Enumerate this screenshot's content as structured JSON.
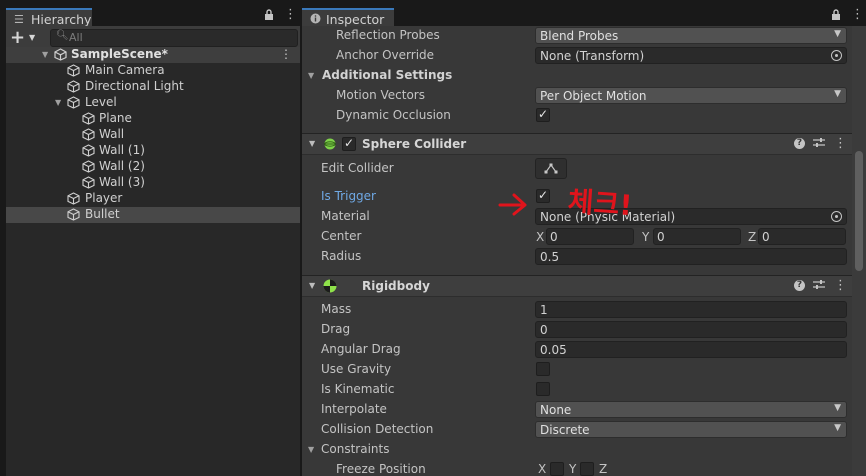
{
  "hierarchy": {
    "tab_label": "Hierarchy",
    "add_label": "+",
    "search_placeholder": "All",
    "scene": "SampleScene*",
    "items": [
      {
        "label": "Main Camera"
      },
      {
        "label": "Directional Light"
      },
      {
        "label": "Level"
      },
      {
        "label": "Plane"
      },
      {
        "label": "Wall"
      },
      {
        "label": "Wall (1)"
      },
      {
        "label": "Wall (2)"
      },
      {
        "label": "Wall (3)"
      },
      {
        "label": "Player"
      },
      {
        "label": "Bullet"
      }
    ]
  },
  "inspector": {
    "tab_label": "Inspector",
    "renderer": {
      "reflection_probes_label": "Reflection Probes",
      "reflection_probes_value": "Blend Probes",
      "anchor_override_label": "Anchor Override",
      "anchor_override_value": "None (Transform)",
      "additional_settings_label": "Additional Settings",
      "motion_vectors_label": "Motion Vectors",
      "motion_vectors_value": "Per Object Motion",
      "dynamic_occlusion_label": "Dynamic Occlusion",
      "dynamic_occlusion_checked": true
    },
    "sphere_collider": {
      "title": "Sphere Collider",
      "enabled": true,
      "edit_collider_label": "Edit Collider",
      "is_trigger_label": "Is Trigger",
      "is_trigger_checked": true,
      "material_label": "Material",
      "material_value": "None (Physic Material)",
      "center_label": "Center",
      "center": {
        "x": "0",
        "y": "0",
        "z": "0"
      },
      "axis_labels": {
        "x": "X",
        "y": "Y",
        "z": "Z"
      },
      "radius_label": "Radius",
      "radius_value": "0.5"
    },
    "rigidbody": {
      "title": "Rigidbody",
      "mass_label": "Mass",
      "mass_value": "1",
      "drag_label": "Drag",
      "drag_value": "0",
      "angular_drag_label": "Angular Drag",
      "angular_drag_value": "0.05",
      "use_gravity_label": "Use Gravity",
      "use_gravity_checked": false,
      "is_kinematic_label": "Is Kinematic",
      "is_kinematic_checked": false,
      "interpolate_label": "Interpolate",
      "interpolate_value": "None",
      "collision_detection_label": "Collision Detection",
      "collision_detection_value": "Discrete",
      "constraints_label": "Constraints",
      "freeze_position_label": "Freeze Position"
    }
  },
  "annotation": {
    "text": "체크!",
    "color": "#e0141c"
  },
  "colors": {
    "accent_tab": "#3a79bb",
    "link_label": "#6fa8e4",
    "collider_icon": "#7fd24a",
    "rigidbody_icon": "#8fe24a"
  }
}
